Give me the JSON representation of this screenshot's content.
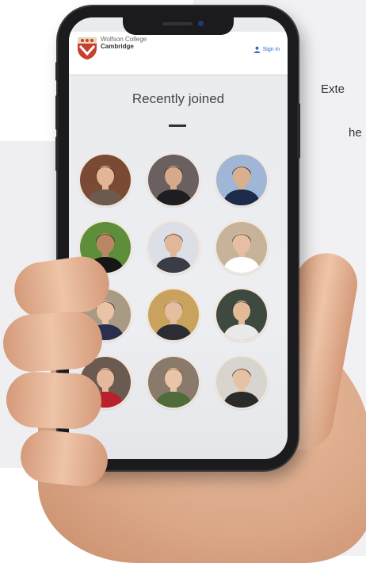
{
  "side_text": [
    "Exte",
    "he"
  ],
  "header": {
    "college_line1": "Wolfson College",
    "college_line2": "Cambridge",
    "signin_label": "Sign in"
  },
  "main": {
    "title": "Recently joined"
  },
  "members": [
    {
      "bg": "#7a4a35",
      "skin": "#e3b594",
      "hair": "#2a1a12",
      "shirt": "#6b5a4d"
    },
    {
      "bg": "#6a6060",
      "skin": "#d5a98a",
      "hair": "#1f1a18",
      "shirt": "#1e1e22"
    },
    {
      "bg": "#9fb6d6",
      "skin": "#d9b08e",
      "hair": "#15110f",
      "shirt": "#1d2b4a"
    },
    {
      "bg": "#5f8e3a",
      "skin": "#b98766",
      "hair": "#2a1c13",
      "shirt": "#161616"
    },
    {
      "bg": "#dcdfe6",
      "skin": "#e0b79a",
      "hair": "#2e2520",
      "shirt": "#3a3d46"
    },
    {
      "bg": "#c7b29a",
      "skin": "#e6bea1",
      "hair": "#3a2619",
      "shirt": "#ffffff"
    },
    {
      "bg": "#a89a84",
      "skin": "#e8c3a6",
      "hair": "#2c1c14",
      "shirt": "#2b2f4f"
    },
    {
      "bg": "#c9a25e",
      "skin": "#e5bd9f",
      "hair": "#7a6656",
      "shirt": "#2c2c34"
    },
    {
      "bg": "#3e4a3f",
      "skin": "#e2ba96",
      "hair": "#121212",
      "shirt": "#e9e9e9"
    },
    {
      "bg": "#6b5a50",
      "skin": "#e4b99b",
      "hair": "#5a3a26",
      "shirt": "#b8202c"
    },
    {
      "bg": "#8a7a6c",
      "skin": "#e8c4a8",
      "hair": "#6b4a30",
      "shirt": "#4f6b3a"
    },
    {
      "bg": "#d8d4cf",
      "skin": "#e6c2a4",
      "hair": "#141010",
      "shirt": "#2a2a2a"
    }
  ]
}
